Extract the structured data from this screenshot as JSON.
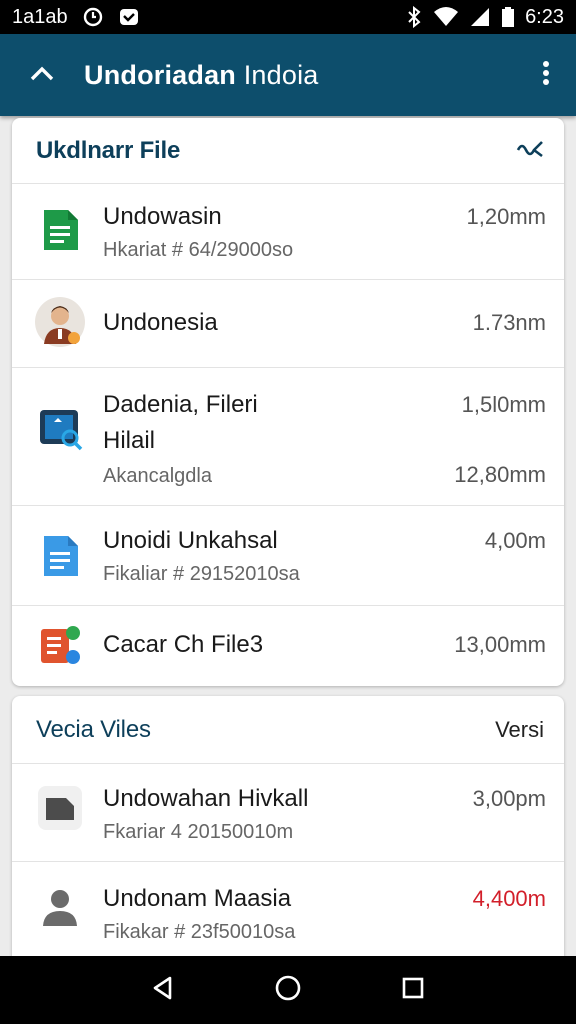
{
  "status_bar": {
    "carrier": "1a1ab",
    "time": "6:23"
  },
  "app_bar": {
    "title_strong": "Undoriadan",
    "title_light": " Indoia"
  },
  "recent_card": {
    "title": "Ukdlnarr File",
    "files": [
      {
        "name": "Undowasin",
        "sub": "Hkariat # 64/29000so",
        "size": "1,20mm",
        "icon": "sheet-icon"
      },
      {
        "name": "Undonesia",
        "sub": "",
        "size": "1.73nm",
        "icon": "person-avatar-icon"
      },
      {
        "name": "Dadenia, Fileri",
        "name2": "Hilail",
        "sub": "Akancalgdla",
        "size": "1,5l0mm",
        "size2": "12,80mm",
        "icon": "tablet-search-icon"
      },
      {
        "name": "Unoidi Unkahsal",
        "sub": "Fikaliar # 29152010sa",
        "size": "4,00m",
        "icon": "doc-icon"
      },
      {
        "name": "Cacar Ch File3",
        "sub": "",
        "size": "13,00mm",
        "icon": "multi-file-icon"
      }
    ]
  },
  "vecia_card": {
    "title": "Vecia Viles",
    "action": "Versi",
    "files": [
      {
        "name": "Undowahan Hivkall",
        "sub": "Fkariar 4 20150010m",
        "size": "3,00pm",
        "icon": "folder-icon"
      },
      {
        "name": "Undonam Maasia",
        "sub": "Fikakar # 23f50010sa",
        "size": "4,400m",
        "icon": "person-icon",
        "size_color": "#d21f2a"
      }
    ]
  },
  "colors": {
    "app_bar": "#0d4e6c",
    "title_text": "#0d3f5a",
    "alert": "#d21f2a"
  }
}
